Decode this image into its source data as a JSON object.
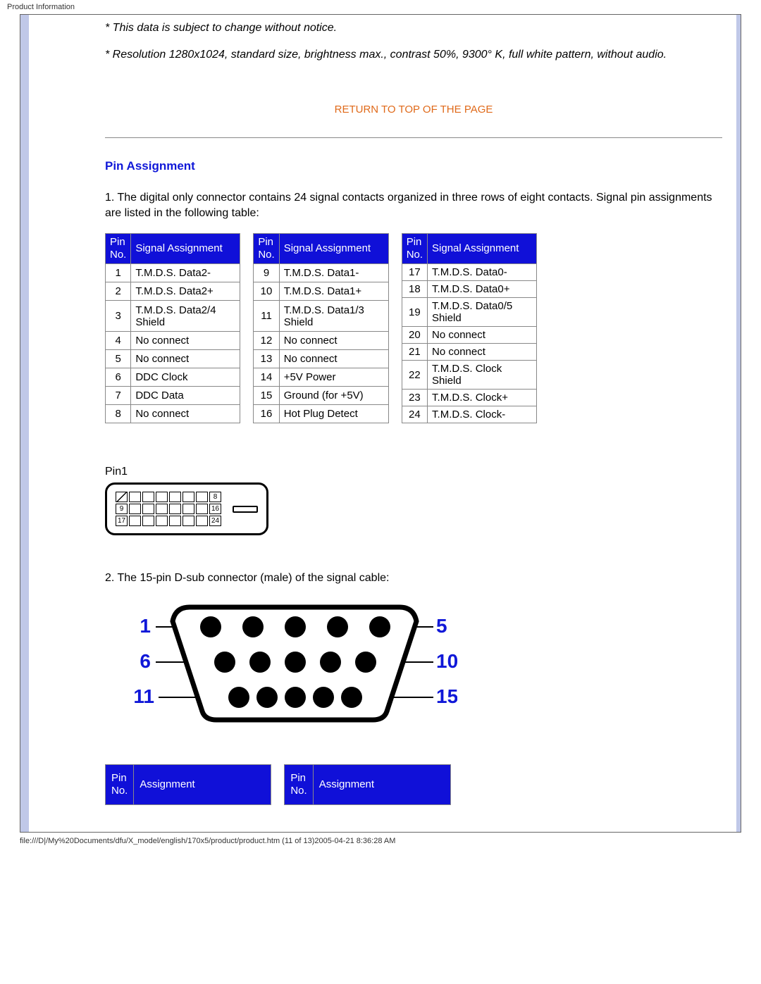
{
  "header": {
    "title": "Product Information"
  },
  "notices": {
    "change": "* This data is subject to change without notice.",
    "resolution": "* Resolution 1280x1024, standard size, brightness max., contrast 50%, 9300° K, full white pattern, without audio."
  },
  "links": {
    "return_top": "RETURN TO TOP OF THE PAGE"
  },
  "section": {
    "pin_assignment_title": "Pin Assignment",
    "intro_1": "1. The digital only connector contains 24 signal contacts organized in three rows of eight contacts. Signal pin assignments are listed in the following table:",
    "pin1_label": "Pin1",
    "intro_2": "2. The 15-pin D-sub connector (male) of the signal cable:"
  },
  "dvi_headers": {
    "pin_no": "Pin No.",
    "signal": "Signal Assignment"
  },
  "dvi_table": {
    "col1": [
      {
        "pin": "1",
        "sig": "T.M.D.S. Data2-"
      },
      {
        "pin": "2",
        "sig": "T.M.D.S. Data2+"
      },
      {
        "pin": "3",
        "sig": "T.M.D.S. Data2/4 Shield"
      },
      {
        "pin": "4",
        "sig": "No connect"
      },
      {
        "pin": "5",
        "sig": "No connect"
      },
      {
        "pin": "6",
        "sig": "DDC Clock"
      },
      {
        "pin": "7",
        "sig": "DDC Data"
      },
      {
        "pin": "8",
        "sig": "No connect"
      }
    ],
    "col2": [
      {
        "pin": "9",
        "sig": "T.M.D.S. Data1-"
      },
      {
        "pin": "10",
        "sig": "T.M.D.S. Data1+"
      },
      {
        "pin": "11",
        "sig": "T.M.D.S. Data1/3 Shield"
      },
      {
        "pin": "12",
        "sig": "No connect"
      },
      {
        "pin": "13",
        "sig": "No connect"
      },
      {
        "pin": "14",
        "sig": "+5V Power"
      },
      {
        "pin": "15",
        "sig": "Ground (for +5V)"
      },
      {
        "pin": "16",
        "sig": "Hot Plug Detect"
      }
    ],
    "col3": [
      {
        "pin": "17",
        "sig": "T.M.D.S. Data0-"
      },
      {
        "pin": "18",
        "sig": "T.M.D.S. Data0+"
      },
      {
        "pin": "19",
        "sig": "T.M.D.S. Data0/5 Shield"
      },
      {
        "pin": "20",
        "sig": "No connect"
      },
      {
        "pin": "21",
        "sig": "No connect"
      },
      {
        "pin": "22",
        "sig": "T.M.D.S. Clock Shield"
      },
      {
        "pin": "23",
        "sig": "T.M.D.S. Clock+"
      },
      {
        "pin": "24",
        "sig": "T.M.D.S. Clock-"
      }
    ]
  },
  "dvi_diagram": {
    "row1_end": "8",
    "row2_start": "9",
    "row2_end": "16",
    "row3_start": "17",
    "row3_end": "24"
  },
  "dsub_diagram": {
    "labels": {
      "l1": "1",
      "l5": "5",
      "l6": "6",
      "l10": "10",
      "l11": "11",
      "l15": "15"
    }
  },
  "vga_headers": {
    "pin_no": "Pin No.",
    "assignment": "Assignment"
  },
  "footer": {
    "path": "file:///D|/My%20Documents/dfu/X_model/english/170x5/product/product.htm (11 of 13)2005-04-21 8:36:28 AM"
  }
}
